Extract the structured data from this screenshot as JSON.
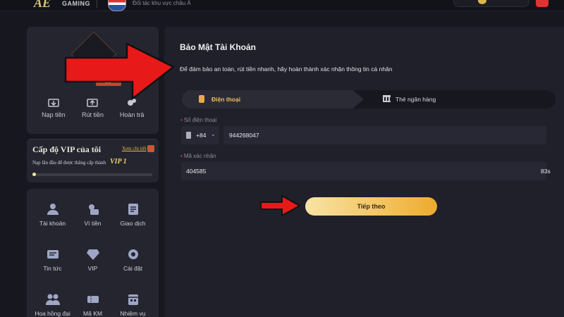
{
  "topbar": {
    "logo_mark": "AE",
    "logo_text": "GAMING",
    "partner_text": "Đối tác khu vực châu Á"
  },
  "profile": {
    "vip_chip": "VIP",
    "actions": [
      {
        "label": "Nạp tiền",
        "icon": "deposit-icon"
      },
      {
        "label": "Rút tiền",
        "icon": "withdraw-icon"
      },
      {
        "label": "Hoàn trả",
        "icon": "rebate-icon"
      }
    ]
  },
  "vip_card": {
    "title": "Cấp độ VIP của tôi",
    "detail_link": "Xem chi tiết",
    "note": "Nạp lần đầu để được thăng cấp thành",
    "level": "VIP 1",
    "progress": 0.0
  },
  "menu": {
    "items": [
      {
        "label": "Tài khoản",
        "icon": "account-icon"
      },
      {
        "label": "Ví tiền",
        "icon": "wallet-icon"
      },
      {
        "label": "Giao dịch",
        "icon": "transactions-icon"
      },
      {
        "label": "Tin tức",
        "icon": "news-icon"
      },
      {
        "label": "VIP",
        "icon": "diamond-icon"
      },
      {
        "label": "Cài đặt",
        "icon": "settings-icon"
      },
      {
        "label": "Hoa hồng đại lý",
        "icon": "agent-icon"
      },
      {
        "label": "Mã KM",
        "icon": "promo-code-icon"
      },
      {
        "label": "Nhiệm vụ",
        "icon": "missions-icon"
      }
    ]
  },
  "main": {
    "title": "Bảo Mật Tài Khoản",
    "description": "Để đảm bảo an toàn, rút tiền nhanh, hãy hoàn thành xác nhận thông tin cá nhân",
    "tabs": [
      {
        "label": "Điện thoại",
        "active": true,
        "icon": "phone-icon"
      },
      {
        "label": "Thẻ ngân hàng",
        "active": false,
        "icon": "bank-icon"
      }
    ],
    "phone_label": "Số điện thoại",
    "country_code": "+84",
    "phone_value": "944268047",
    "code_label": "Mã xác nhận",
    "code_value": "404585",
    "countdown": "83s",
    "next_button": "Tiếp theo"
  },
  "colors": {
    "accent": "#f0bd5a",
    "button_start": "#f8e3a5",
    "button_end": "#eeaa2f",
    "annotation_red": "#e81919"
  }
}
